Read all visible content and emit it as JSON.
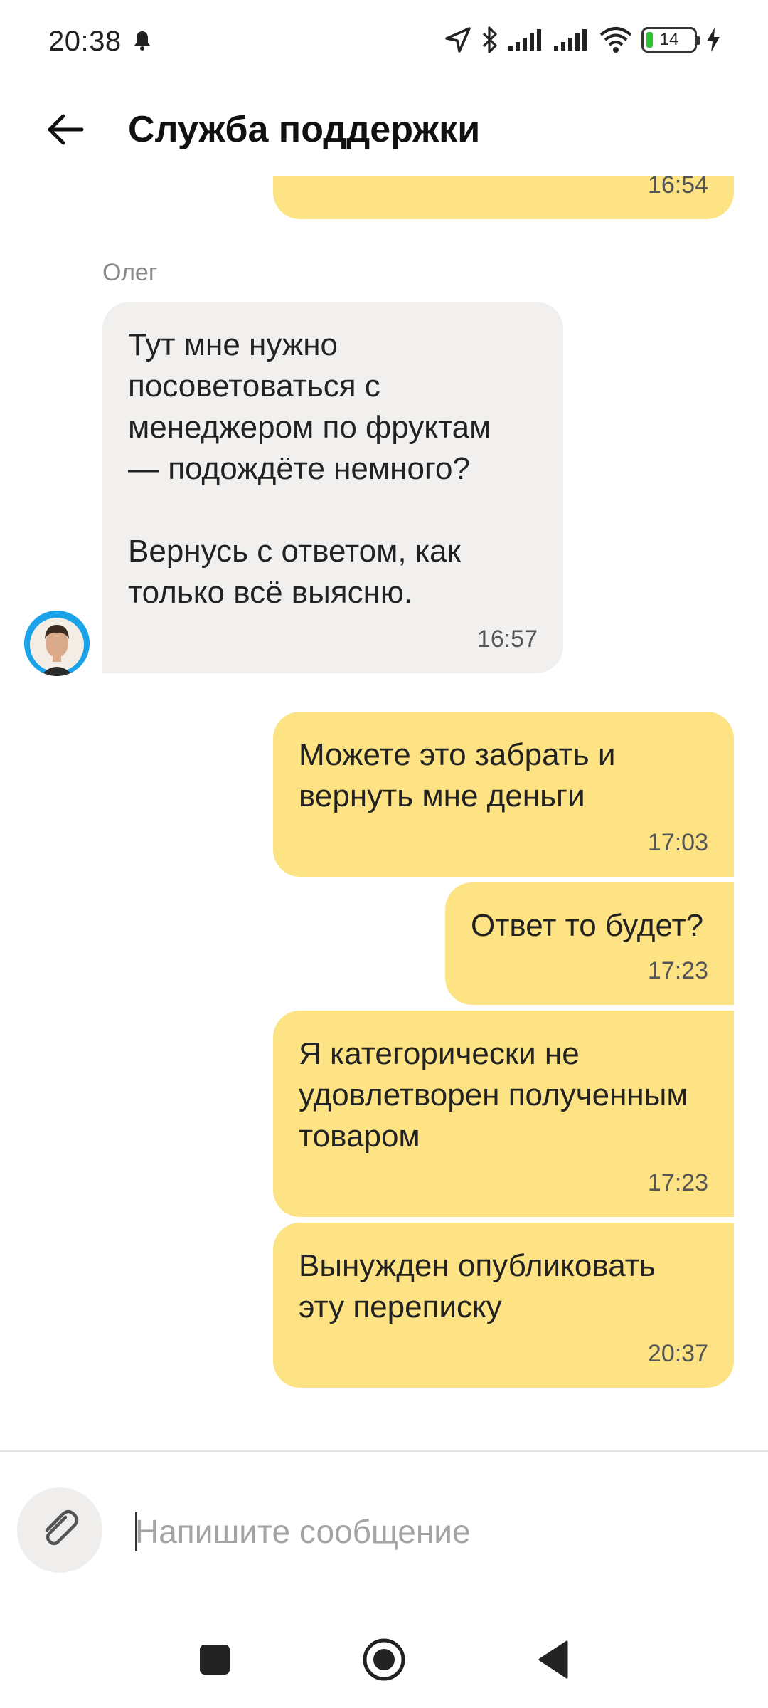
{
  "status_bar": {
    "time": "20:38",
    "battery": "14",
    "icons": [
      "bell-icon",
      "location-icon",
      "bluetooth-icon",
      "signal-icon",
      "signal-icon",
      "wifi-icon",
      "battery-icon",
      "charging-icon"
    ]
  },
  "header": {
    "title": "Служба поддержки",
    "back_icon": "arrow-left-icon"
  },
  "messages": [
    {
      "direction": "out",
      "text": "",
      "time": "16:54",
      "partial": true
    },
    {
      "direction": "in",
      "sender": "Олег",
      "text": "Тут мне нужно\nпосоветоваться с\nменеджером по фруктам\n— подождёте немного?\n\nВернусь с ответом, как\nтолько всё выясню.",
      "time": "16:57"
    },
    {
      "direction": "out",
      "text": "Можете это забрать и\nвернуть мне деньги",
      "time": "17:03"
    },
    {
      "direction": "out",
      "text": "Ответ то будет?",
      "time": "17:23"
    },
    {
      "direction": "out",
      "text": "Я категорически не\nудовлетворен полученным\nтоваром",
      "time": "17:23"
    },
    {
      "direction": "out",
      "text": "Вынужден опубликовать\nэту переписку",
      "time": "20:37"
    }
  ],
  "composer": {
    "placeholder": "Напишите сообщение",
    "value": "",
    "attach_icon": "paperclip-icon"
  },
  "nav_bar": {
    "buttons": [
      "recents-square-icon",
      "home-circle-icon",
      "back-triangle-icon"
    ]
  },
  "colors": {
    "outgoing_bubble": "#fde384",
    "incoming_bubble": "#f1f0ee",
    "avatar_ring": "#1aa3e8"
  }
}
